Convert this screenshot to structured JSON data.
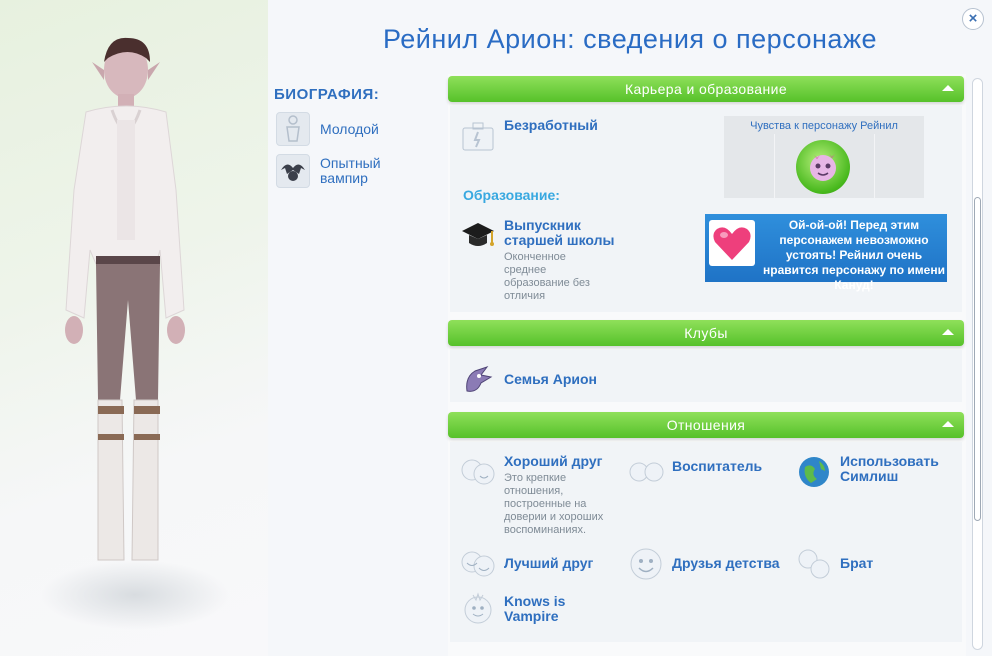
{
  "title": "Рейнил Арион: сведения о персонаже",
  "close_label": "×",
  "biography": {
    "heading": "БИОГРАФИЯ:",
    "items": [
      {
        "label": "Молодой",
        "icon": "young-adult-icon"
      },
      {
        "label": "Опытный вампир",
        "icon": "vampire-icon"
      }
    ]
  },
  "career": {
    "heading": "Карьера и образование",
    "job": {
      "label": "Безработный",
      "icon": "briefcase-icon"
    },
    "education_heading": "Образование:",
    "education": {
      "label": "Выпускник старшей школы",
      "desc": "Оконченное среднее образование без отличия",
      "icon": "graduation-cap-icon"
    },
    "feelings": {
      "title": "Чувства к персонажу Рейнил",
      "icon": "smitten-icon"
    },
    "tooltip": "Ой-ой-ой! Перед этим персонажем невозможно устоять! Рейнил очень нравится персонажу по имени Кануд!"
  },
  "clubs": {
    "heading": "Клубы",
    "items": [
      {
        "label": "Семья Арион",
        "icon": "dragon-club-icon"
      }
    ]
  },
  "relationships": {
    "heading": "Отношения",
    "items": [
      {
        "label": "Хороший друг",
        "desc": "Это крепкие отношения, построенные на доверии и хороших воспоминаниях.",
        "icon": "good-friend-icon"
      },
      {
        "label": "Воспитатель",
        "icon": "caregiver-icon"
      },
      {
        "label": "Использовать Симлиш",
        "icon": "globe-icon"
      },
      {
        "label": "Лучший друг",
        "icon": "best-friend-icon"
      },
      {
        "label": "Друзья детства",
        "icon": "childhood-friends-icon"
      },
      {
        "label": "Брат",
        "icon": "sibling-icon"
      },
      {
        "label": "Knows is Vampire",
        "icon": "knows-vampire-icon"
      }
    ]
  },
  "colors": {
    "accent": "#2f6fbf",
    "section_green": "#56c12a",
    "subheading": "#38a8e0"
  }
}
